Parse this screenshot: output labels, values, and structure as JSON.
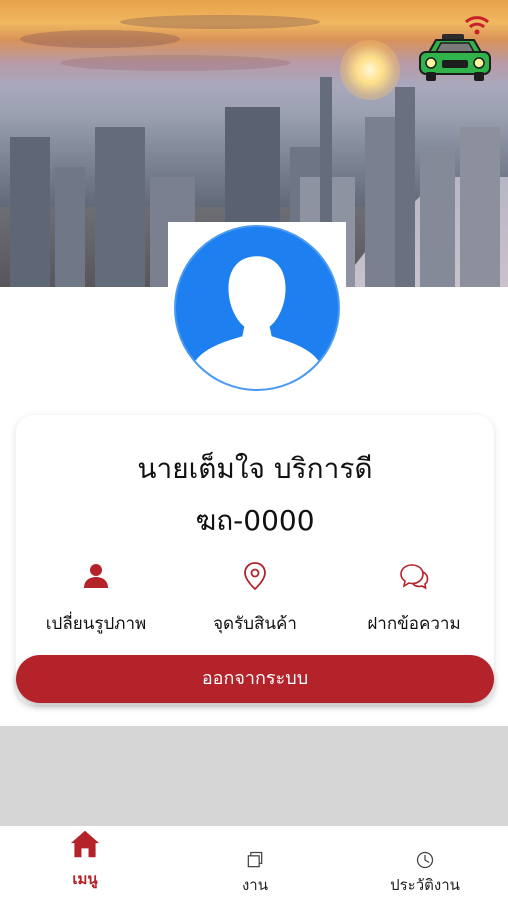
{
  "profile": {
    "name": "นายเต็มใจ บริการดี",
    "plate": "ฆถ-0000"
  },
  "actions": [
    {
      "label": "เปลี่ยนรูปภาพ",
      "icon": "person-icon"
    },
    {
      "label": "จุดรับสินค้า",
      "icon": "location-pin-icon"
    },
    {
      "label": "ฝากข้อความ",
      "icon": "chat-bubble-icon"
    }
  ],
  "logout_label": "ออกจากระบบ",
  "nav": [
    {
      "label": "เมนู",
      "icon": "home-icon",
      "active": true
    },
    {
      "label": "งาน",
      "icon": "copy-icon",
      "active": false
    },
    {
      "label": "ประวัติงาน",
      "icon": "history-clock-icon",
      "active": false
    }
  ],
  "colors": {
    "accent": "#b5232a",
    "avatar_blue": "#1e7ff0",
    "taxi_green": "#2fb34a"
  }
}
